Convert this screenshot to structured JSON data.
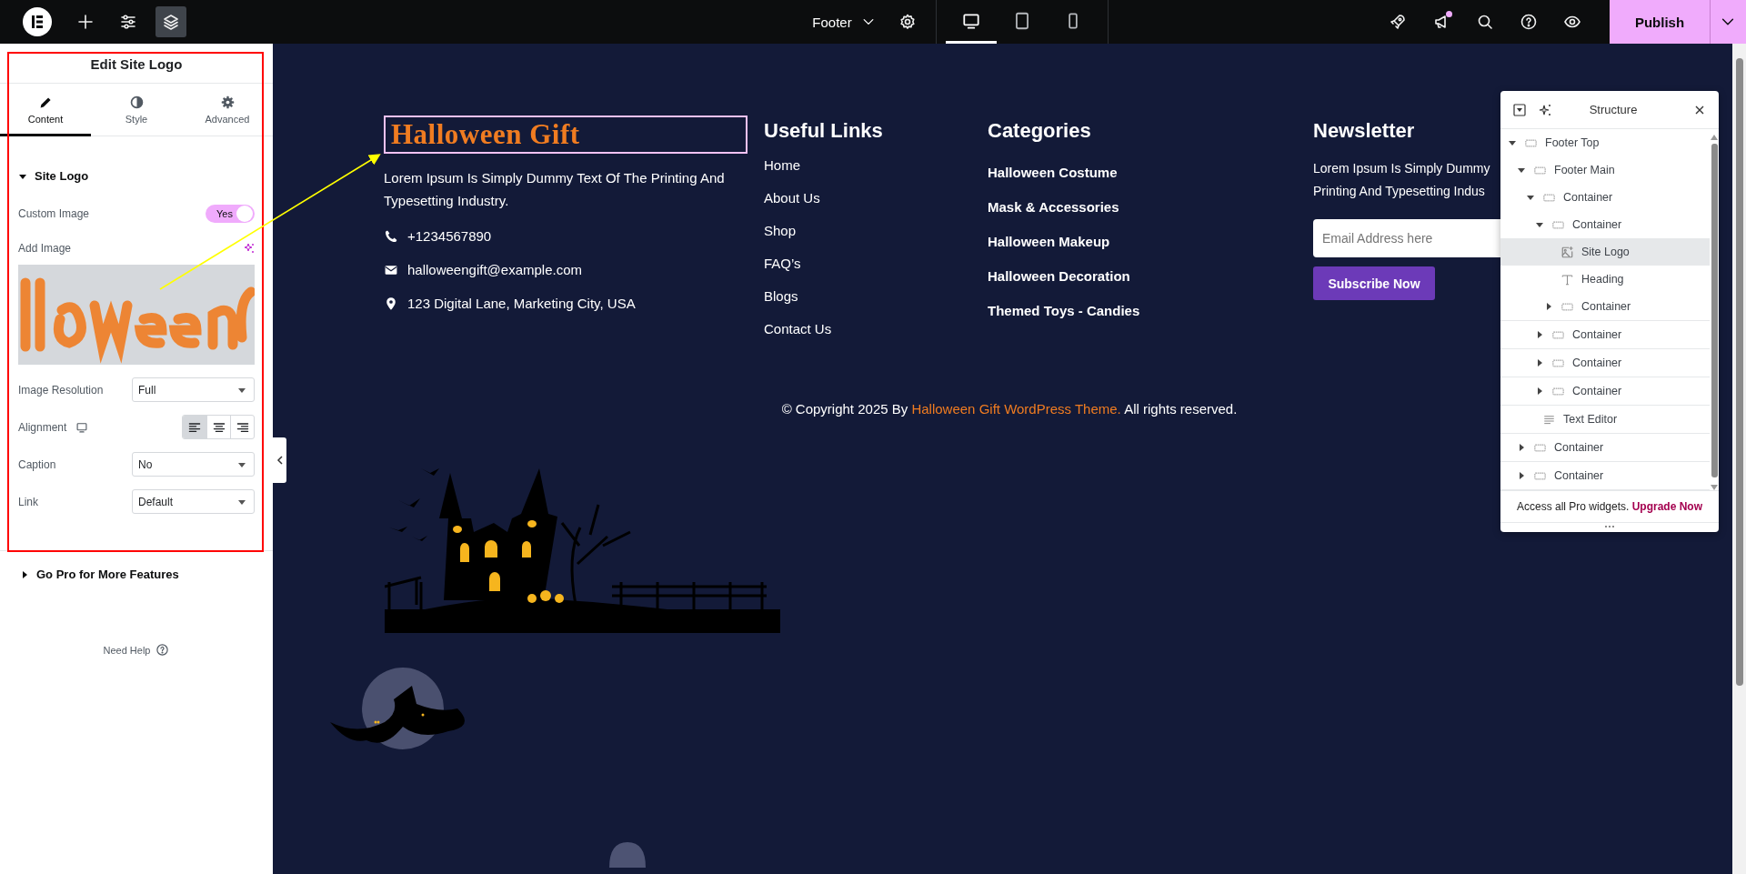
{
  "topbar": {
    "tools": [
      {
        "kind": "add",
        "selected": false
      },
      {
        "kind": "settings",
        "selected": false
      },
      {
        "kind": "structure",
        "selected": true
      }
    ],
    "document": "Footer",
    "devices": [
      {
        "kind": "desktop",
        "selected": true
      },
      {
        "kind": "tablet",
        "selected": false
      },
      {
        "kind": "mobile",
        "selected": false
      }
    ],
    "actions": [
      {
        "kind": "rocket",
        "badge": false
      },
      {
        "kind": "whats-new",
        "badge": true
      },
      {
        "kind": "search",
        "badge": false
      },
      {
        "kind": "help",
        "badge": false
      },
      {
        "kind": "preview",
        "badge": false
      }
    ],
    "publish": "Publish"
  },
  "panel": {
    "title": "Edit Site Logo",
    "tabs": [
      {
        "kind": "content",
        "label": "Content",
        "selected": true
      },
      {
        "kind": "style",
        "label": "Style",
        "selected": false
      },
      {
        "kind": "advanced",
        "label": "Advanced",
        "selected": false
      }
    ],
    "section": {
      "title": "Site Logo",
      "expanded": true
    },
    "controls": [
      {
        "kind": "toggle",
        "label": "Custom Image",
        "value": "Yes",
        "on": true
      },
      {
        "kind": "image",
        "label": "Add Image"
      },
      {
        "kind": "select",
        "label": "Image Resolution",
        "value": "Full"
      },
      {
        "kind": "alignment",
        "label": "Alignment",
        "options": [
          {
            "kind": "left",
            "selected": true
          },
          {
            "kind": "center",
            "selected": false
          },
          {
            "kind": "right",
            "selected": false
          }
        ]
      },
      {
        "kind": "select",
        "label": "Caption",
        "value": "No"
      },
      {
        "kind": "select",
        "label": "Link",
        "value": "Default"
      }
    ],
    "pro_section": {
      "title": "Go Pro for More Features",
      "expanded": false
    },
    "help": "Need Help"
  },
  "footer": {
    "logo": {
      "text": "Halloween Gift",
      "selected": true
    },
    "about": "Lorem Ipsum Is Simply Dummy Text Of The Printing And Typesetting Industry.",
    "contacts": [
      {
        "kind": "phone",
        "text": "+1234567890"
      },
      {
        "kind": "email",
        "text": "halloweengift@example.com"
      },
      {
        "kind": "location",
        "text": "123 Digital Lane, Marketing City, USA"
      }
    ],
    "columns": [
      {
        "title": "Useful Links",
        "links": [
          "Home",
          "About Us",
          "Shop",
          "FAQ’s",
          "Blogs",
          "Contact Us"
        ]
      },
      {
        "title": "Categories",
        "links": [
          "Halloween Costume",
          "Mask & Accessories",
          "Halloween Makeup",
          "Halloween Decoration",
          "Themed Toys - Candies"
        ]
      }
    ],
    "newsletter": {
      "title": "Newsletter",
      "lines": [
        "Lorem Ipsum Is Simply Dummy",
        "Printing And Typesetting Indus"
      ],
      "placeholder": "Email Address here",
      "button": "Subscribe Now"
    },
    "copyright": {
      "before": "© Copyright 2025 By",
      "link": "Halloween Gift WordPress Theme.",
      "after": "All rights reserved."
    }
  },
  "structure": {
    "title": "Structure",
    "tree": [
      {
        "kind": "container",
        "label": "Footer Top",
        "expanded": true,
        "selected": false,
        "children": [
          {
            "kind": "container",
            "label": "Footer Main",
            "expanded": true,
            "selected": false,
            "children": [
              {
                "kind": "container",
                "label": "Container",
                "expanded": true,
                "selected": false,
                "children": [
                  {
                    "kind": "container",
                    "label": "Container",
                    "expanded": true,
                    "selected": false,
                    "children": [
                      {
                        "kind": "site-logo",
                        "label": "Site Logo",
                        "selected": true
                      },
                      {
                        "kind": "heading",
                        "label": "Heading",
                        "selected": false
                      },
                      {
                        "kind": "container",
                        "label": "Container",
                        "expanded": false,
                        "selected": false
                      }
                    ]
                  },
                  {
                    "kind": "container",
                    "label": "Container",
                    "expanded": false,
                    "selected": false
                  },
                  {
                    "kind": "container",
                    "label": "Container",
                    "expanded": false,
                    "selected": false
                  },
                  {
                    "kind": "container",
                    "label": "Container",
                    "expanded": false,
                    "selected": false
                  }
                ]
              },
              {
                "kind": "text-editor",
                "label": "Text Editor",
                "selected": false
              }
            ]
          },
          {
            "kind": "container",
            "label": "Container",
            "expanded": false,
            "selected": false
          },
          {
            "kind": "container",
            "label": "Container",
            "expanded": false,
            "selected": false
          }
        ]
      }
    ],
    "promo": {
      "text": "Access all Pro widgets.",
      "link": "Upgrade Now"
    }
  }
}
